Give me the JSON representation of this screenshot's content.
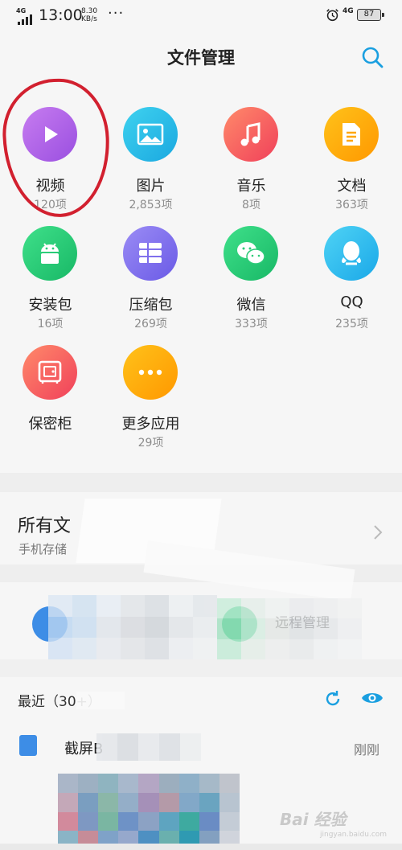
{
  "status_bar": {
    "signal_label": "4G",
    "time": "13:00",
    "net_speed_value": "8.30",
    "net_speed_unit": "KB/s",
    "more_dots": "···",
    "network_type": "4G",
    "battery": "87"
  },
  "header": {
    "title": "文件管理",
    "search_icon": "search-icon"
  },
  "categories": [
    {
      "name": "视频",
      "count": "120项",
      "icon": "play-icon",
      "colors": [
        "#c77cf0",
        "#9a4fe0"
      ]
    },
    {
      "name": "图片",
      "count": "2,853项",
      "icon": "image-icon",
      "colors": [
        "#3fd2ef",
        "#1aa8e0"
      ]
    },
    {
      "name": "音乐",
      "count": "8项",
      "icon": "music-icon",
      "colors": [
        "#ff8a6a",
        "#f0405a"
      ]
    },
    {
      "name": "文档",
      "count": "363项",
      "icon": "document-icon",
      "colors": [
        "#ffc21a",
        "#ff9800"
      ]
    },
    {
      "name": "安装包",
      "count": "16项",
      "icon": "android-icon",
      "colors": [
        "#3fe08a",
        "#18b866"
      ]
    },
    {
      "name": "压缩包",
      "count": "269项",
      "icon": "archive-icon",
      "colors": [
        "#9b8cf5",
        "#6a5ae6"
      ]
    },
    {
      "name": "微信",
      "count": "333项",
      "icon": "wechat-icon",
      "colors": [
        "#3fe08a",
        "#18b866"
      ]
    },
    {
      "name": "QQ",
      "count": "235项",
      "icon": "qq-icon",
      "colors": [
        "#4fd3f5",
        "#1aa8e8"
      ]
    },
    {
      "name": "保密柜",
      "count": "",
      "icon": "safe-icon",
      "colors": [
        "#ff8a6a",
        "#f0405a"
      ]
    },
    {
      "name": "更多应用",
      "count": "29项",
      "icon": "more-apps-icon",
      "colors": [
        "#ffc21a",
        "#ff9800"
      ]
    }
  ],
  "all_files": {
    "title": "所有文",
    "subtitle": "手机存储"
  },
  "tools": {
    "remote_label": "远程管理"
  },
  "recent": {
    "title": "最近（30+）",
    "refresh_icon": "refresh-icon",
    "eye_icon": "eye-icon"
  },
  "recent_items": [
    {
      "name": "截屏B",
      "time": "刚刚"
    }
  ],
  "watermark": {
    "text": "Bai 经验",
    "sub": "jingyan.baidu.com"
  },
  "colors": {
    "accent": "#1a9fe0",
    "annotation": "#d2202f"
  }
}
